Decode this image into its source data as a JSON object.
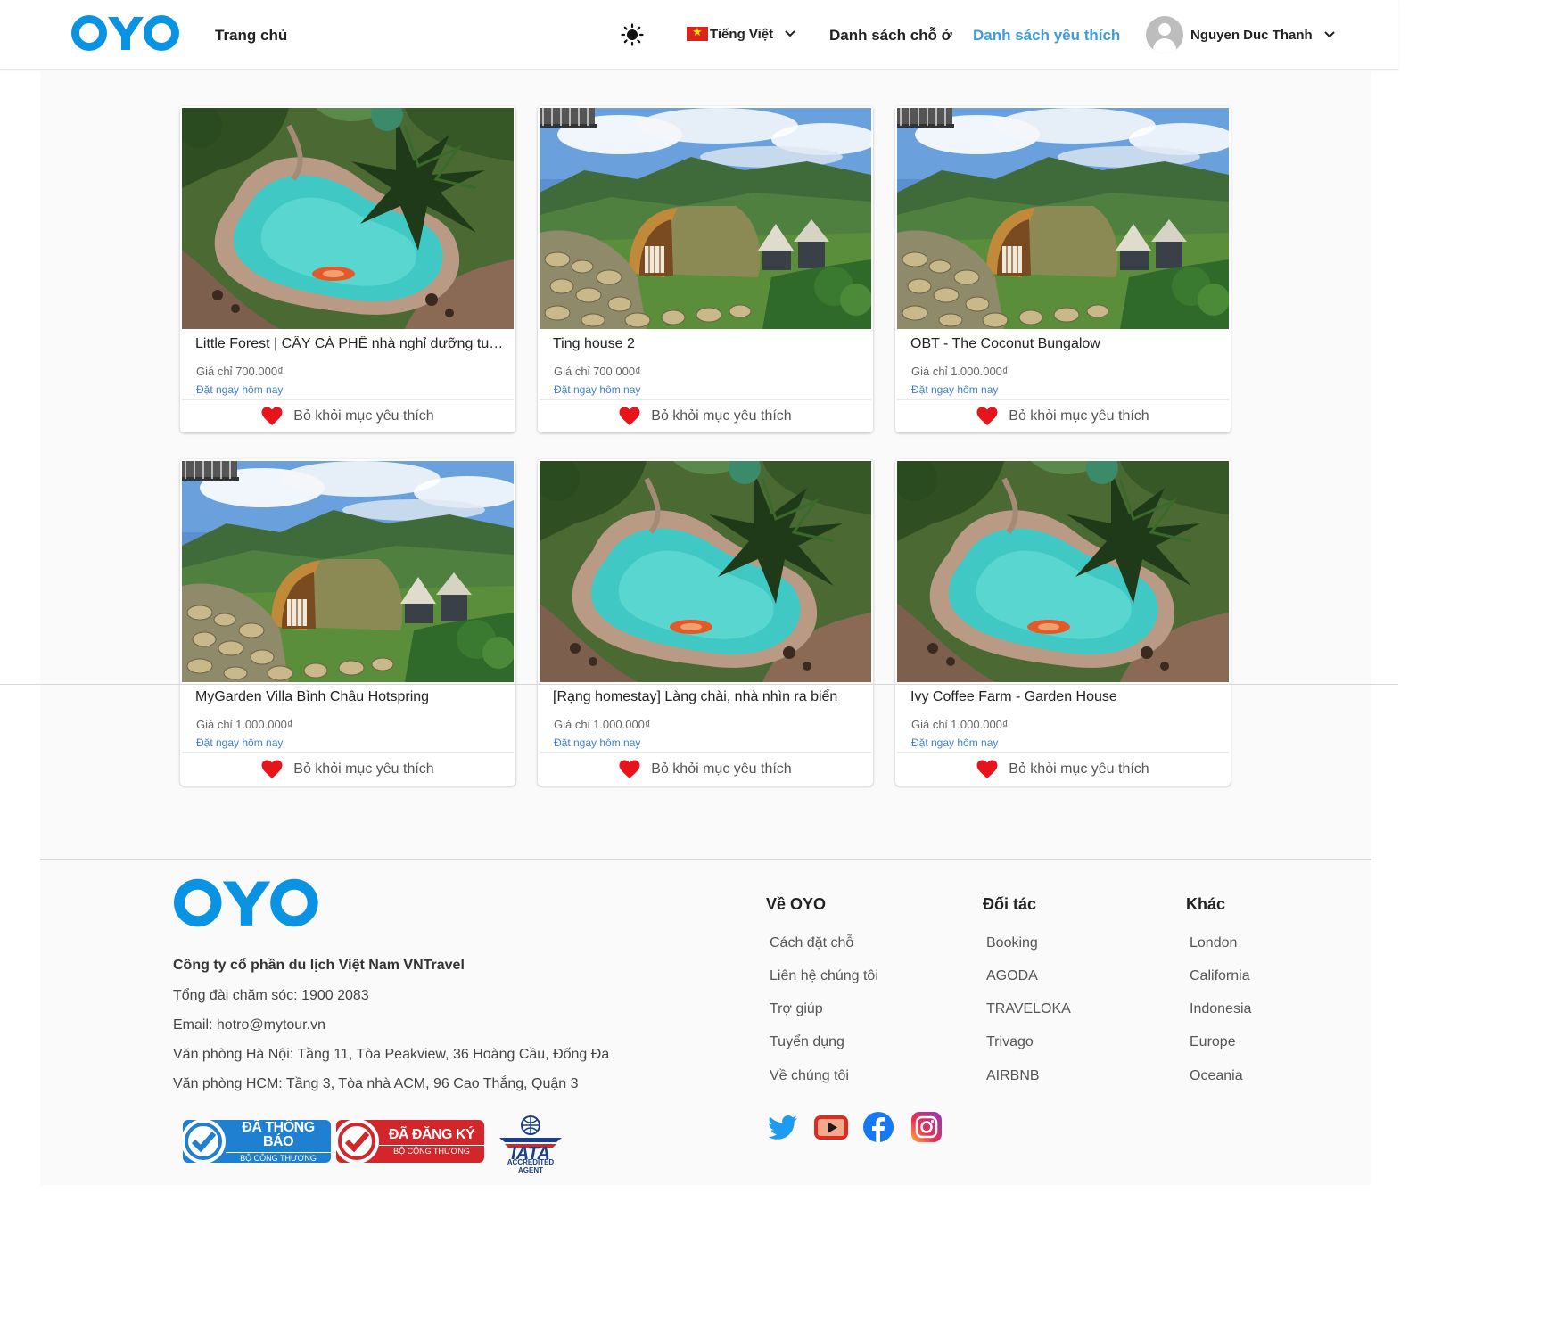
{
  "header": {
    "logo_text": "OYO",
    "home": "Trang chủ",
    "language": "Tiếng Việt",
    "accommodations": "Danh sách chỗ ở",
    "favorites": "Danh sách yêu thích",
    "user_name": "Nguyen Duc Thanh"
  },
  "cards": [
    {
      "title": "Little Forest | CÂY CÀ PHÊ nhà nghỉ dưỡng tuyệt ...",
      "price": "Giá chỉ 700.000₫",
      "book": "Đặt ngay hôm nay",
      "action": "Bỏ khỏi mục yêu thích",
      "image": "pool"
    },
    {
      "title": "Ting house 2",
      "price": "Giá chỉ 700.000₫",
      "book": "Đặt ngay hôm nay",
      "action": "Bỏ khỏi mục yêu thích",
      "image": "mountain"
    },
    {
      "title": "OBT - The Coconut Bungalow",
      "price": "Giá chỉ 1.000.000₫",
      "book": "Đặt ngay hôm nay",
      "action": "Bỏ khỏi mục yêu thích",
      "image": "mountain"
    },
    {
      "title": "MyGarden Villa Bình Châu Hotspring",
      "price": "Giá chỉ 1.000.000₫",
      "book": "Đặt ngay hôm nay",
      "action": "Bỏ khỏi mục yêu thích",
      "image": "mountain"
    },
    {
      "title": "[Rạng homestay] Làng chài, nhà nhìn ra biển",
      "price": "Giá chỉ 1.000.000₫",
      "book": "Đặt ngay hôm nay",
      "action": "Bỏ khỏi mục yêu thích",
      "image": "pool"
    },
    {
      "title": "Ivy Coffee Farm - Garden House",
      "price": "Giá chỉ 1.000.000₫",
      "book": "Đặt ngay hôm nay",
      "action": "Bỏ khỏi mục yêu thích",
      "image": "pool"
    }
  ],
  "footer": {
    "logo_text": "OYO",
    "company": "Công ty cổ phần du lịch Việt Nam VNTravel",
    "hotline": "Tổng đài chăm sóc: 1900 2083",
    "email": "Email: hotro@mytour.vn",
    "office_hn": "Văn phòng Hà Nội: Tầng 11, Tòa Peakview, 36 Hoàng Cầu, Đống Đa",
    "office_hcm": "Văn phòng HCM: Tầng 3, Tòa nhà ACM, 96 Cao Thắng, Quận 3",
    "columns": [
      {
        "title": "Về OYO",
        "links": [
          "Cách đặt chỗ",
          "Liên hệ chúng tôi",
          "Trợ giúp",
          "Tuyển dụng",
          "Về chúng tôi"
        ]
      },
      {
        "title": "Đối tác",
        "links": [
          "Booking",
          "AGODA",
          "TRAVELOKA",
          "Trivago",
          "AIRBNB"
        ]
      },
      {
        "title": "Khác",
        "links": [
          "London",
          "California",
          "Indonesia",
          "Europe",
          "Oceania"
        ]
      }
    ],
    "badge_notified": {
      "title": "ĐÃ THÔNG BÁO",
      "sub": "BỘ CÔNG THƯƠNG"
    },
    "badge_registered": {
      "title": "ĐÃ ĐĂNG KÝ",
      "sub": "BỘ CÔNG THƯƠNG"
    },
    "iata": {
      "title": "IATA",
      "sub": "ACCREDITED AGENT"
    },
    "social": [
      "twitter-icon",
      "youtube-icon",
      "facebook-icon",
      "instagram-icon"
    ]
  },
  "colors": {
    "brand": "#0a93e2",
    "link": "#3e9ce0",
    "heart": "#e8141c"
  }
}
